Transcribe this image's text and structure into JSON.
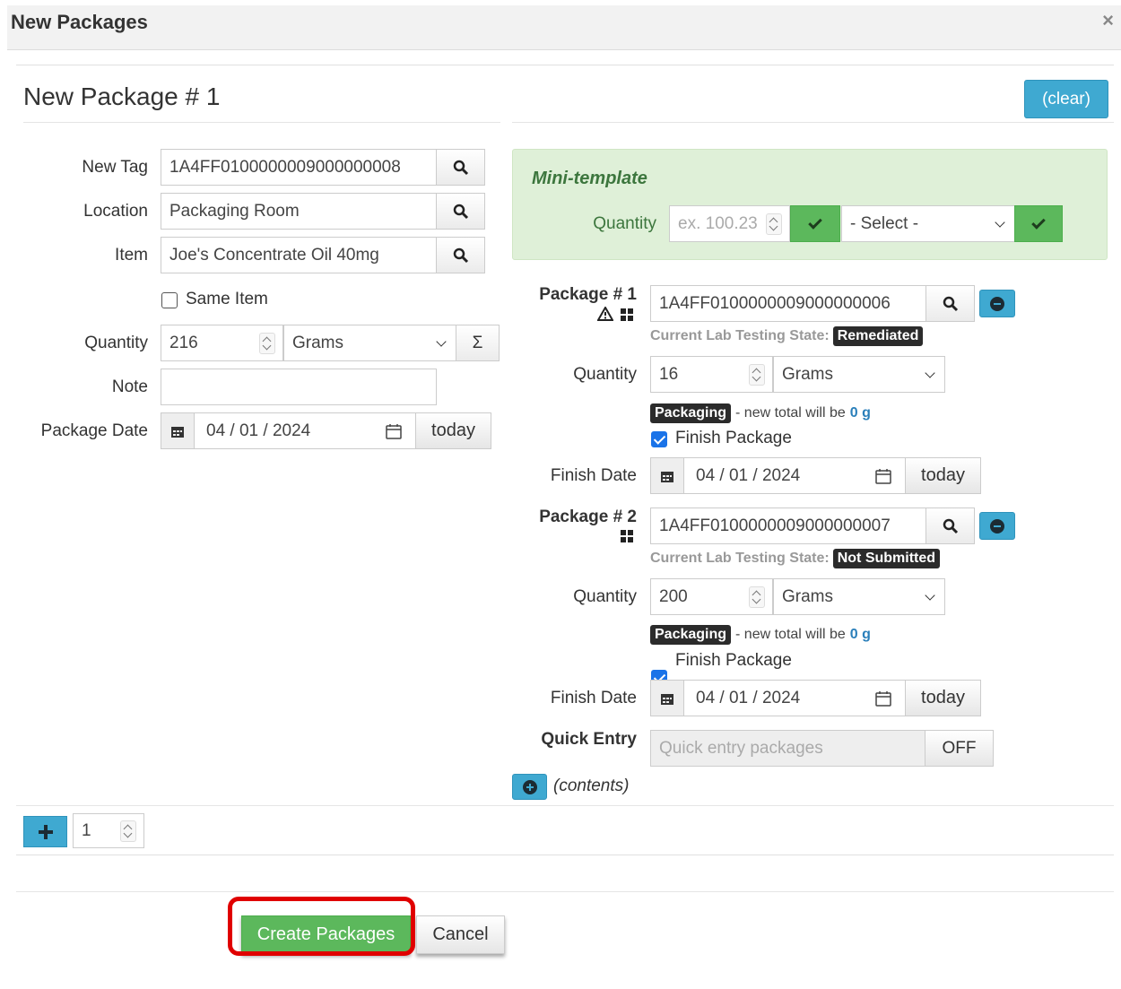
{
  "dialog": {
    "title": "New Packages",
    "close": "×"
  },
  "package": {
    "heading": "New Package # 1",
    "clear_label": "(clear)",
    "new_tag": {
      "label": "New Tag",
      "value": "1A4FF0100000009000000008"
    },
    "location": {
      "label": "Location",
      "value": "Packaging Room"
    },
    "item": {
      "label": "Item",
      "value": "Joe's Concentrate Oil 40mg"
    },
    "same_item": {
      "label": "Same Item",
      "checked": false
    },
    "quantity": {
      "label": "Quantity",
      "value": "216",
      "unit": "Grams",
      "sum_label": "Σ"
    },
    "note": {
      "label": "Note",
      "value": ""
    },
    "package_date": {
      "label": "Package Date",
      "value": "04 / 01 / 2024",
      "today": "today"
    }
  },
  "mini_template": {
    "title": "Mini-template",
    "quantity_label": "Quantity",
    "quantity_placeholder": "ex. 100.23",
    "select_value": "- Select -"
  },
  "sources": [
    {
      "label": "Package # 1",
      "tag": "1A4FF0100000009000000006",
      "lab_state_label": "Current Lab Testing State:",
      "lab_state": "Remediated",
      "quantity_label": "Quantity",
      "quantity": "16",
      "unit": "Grams",
      "badge": "Packaging",
      "note_prefix": "- new total will be",
      "note_value": "0 g",
      "finish_label": "Finish Package",
      "finish_checked": true,
      "finish_date_label": "Finish Date",
      "finish_date": "04 / 01 / 2024",
      "today": "today"
    },
    {
      "label": "Package # 2",
      "tag": "1A4FF0100000009000000007",
      "lab_state_label": "Current Lab Testing State:",
      "lab_state": "Not Submitted",
      "quantity_label": "Quantity",
      "quantity": "200",
      "unit": "Grams",
      "badge": "Packaging",
      "note_prefix": "- new total will be",
      "note_value": "0 g",
      "finish_label": "Finish Package",
      "finish_checked": true,
      "finish_date_label": "Finish Date",
      "finish_date": "04 / 01 / 2024",
      "today": "today"
    }
  ],
  "quick_entry": {
    "label": "Quick Entry",
    "placeholder": "Quick entry packages",
    "toggle": "OFF"
  },
  "contents_label": "(contents)",
  "add_count": "1",
  "footer": {
    "create": "Create Packages",
    "cancel": "Cancel"
  },
  "colors": {
    "primary": "#3fa9d1",
    "success": "#5cb85c",
    "mini_bg": "#dff0d8",
    "highlight": "#e00000"
  }
}
